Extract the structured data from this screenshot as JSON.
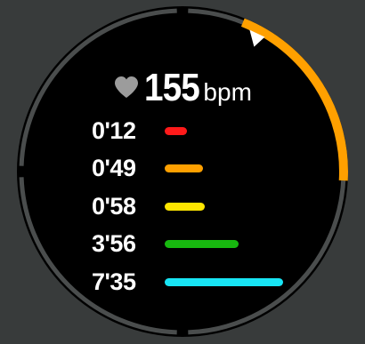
{
  "heart_rate": {
    "icon": "heart-icon",
    "value": "155",
    "unit": "bpm"
  },
  "zones": [
    {
      "time": "0'12",
      "color": "#ff1a1a",
      "fill": 0.1
    },
    {
      "time": "0'49",
      "color": "#ffa000",
      "fill": 0.17
    },
    {
      "time": "0'58",
      "color": "#ffe600",
      "fill": 0.18
    },
    {
      "time": "3'56",
      "color": "#17b80f",
      "fill": 0.33
    },
    {
      "time": "7'35",
      "color": "#18e4f4",
      "fill": 0.53
    }
  ],
  "colors": {
    "background": "#383b3b",
    "watch_face": "#000000",
    "bezel": "#4a4d4d",
    "arc_accent": "#ffa000",
    "text": "#ffffff",
    "heart": "#9c9c9c"
  },
  "progress_arc": {
    "fraction": 0.17
  }
}
